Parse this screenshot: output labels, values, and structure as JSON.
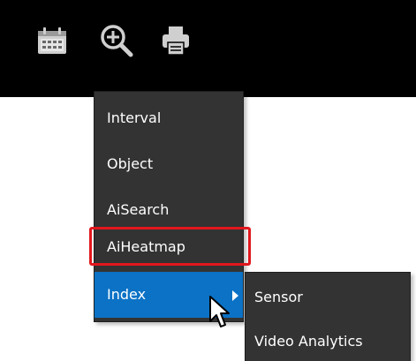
{
  "toolbar": {
    "buttons": [
      {
        "icon": "calendar-icon"
      },
      {
        "icon": "zoom-icon"
      },
      {
        "icon": "print-icon"
      }
    ]
  },
  "menu": {
    "items": [
      {
        "label": "Interval"
      },
      {
        "label": "Object"
      },
      {
        "label": "AiSearch"
      },
      {
        "label": "AiHeatmap",
        "highlighted": true
      },
      {
        "label": "Index",
        "active": true,
        "has_submenu": true
      }
    ],
    "active_color": "#0b72c6",
    "background_color": "#333333",
    "highlight_color": "#e2171d"
  },
  "submenu": {
    "items": [
      {
        "label": "Sensor"
      },
      {
        "label": "Video Analytics"
      }
    ]
  }
}
